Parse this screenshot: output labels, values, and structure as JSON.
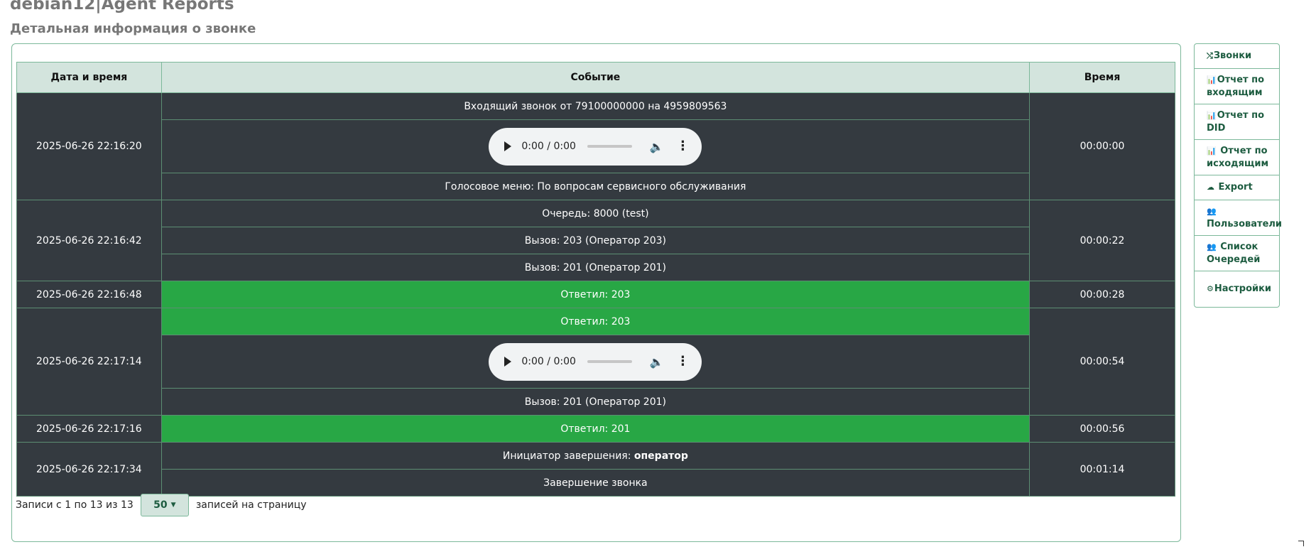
{
  "header": {
    "app_title": "debian12|Agent Reports",
    "subtitle": "Детальная информация о звонке"
  },
  "table": {
    "columns": [
      "Дата и время",
      "Событие",
      "Время"
    ],
    "groups": [
      {
        "datetime": "2025-06-26 22:16:20",
        "duration": "00:00:00",
        "events": [
          {
            "type": "text",
            "text": "Входящий звонок от 79100000000 на 4959809563"
          },
          {
            "type": "audio",
            "time": "0:00 / 0:00"
          },
          {
            "type": "text",
            "text": "Голосовое меню: По вопросам сервисного обслуживания"
          }
        ]
      },
      {
        "datetime": "2025-06-26 22:16:42",
        "duration": "00:00:22",
        "events": [
          {
            "type": "text",
            "text": "Очередь: 8000 (test)"
          },
          {
            "type": "text",
            "text": "Вызов: 203 (Оператор 203)"
          },
          {
            "type": "text",
            "text": "Вызов: 201 (Оператор 201)"
          }
        ]
      },
      {
        "datetime": "2025-06-26 22:16:48",
        "duration": "00:00:28",
        "events": [
          {
            "type": "answered",
            "text": "Ответил: 203"
          }
        ]
      },
      {
        "datetime": "2025-06-26 22:17:14",
        "duration": "00:00:54",
        "events": [
          {
            "type": "answered",
            "text": "Ответил: 203"
          },
          {
            "type": "audio",
            "time": "0:00 / 0:00"
          },
          {
            "type": "text",
            "text": "Вызов: 201 (Оператор 201)"
          }
        ]
      },
      {
        "datetime": "2025-06-26 22:17:16",
        "duration": "00:00:56",
        "events": [
          {
            "type": "answered",
            "text": "Ответил: 201"
          }
        ]
      },
      {
        "datetime": "2025-06-26 22:17:34",
        "duration": "00:01:14",
        "events": [
          {
            "type": "text",
            "text": "Инициатор завершения: ",
            "bold": "оператор"
          },
          {
            "type": "text",
            "text": "Завершение звонка"
          }
        ]
      }
    ]
  },
  "pager": {
    "info": "Записи с 1 по 13 из 13",
    "page_size": "50",
    "suffix": "записей на страницу"
  },
  "side_menu": [
    {
      "icon": "shuffle-icon",
      "glyph": "⤭",
      "label": "Звонки"
    },
    {
      "icon": "bar-chart-icon",
      "glyph": "📊",
      "label": "Отчет по входящим"
    },
    {
      "icon": "bar-chart-icon",
      "glyph": "📊",
      "label": "Отчет по DID"
    },
    {
      "icon": "bar-chart-icon",
      "glyph": "📊",
      "label": " Отчет по исходящим"
    },
    {
      "icon": "cloud-download-icon",
      "glyph": "☁",
      "label": " Export"
    },
    {
      "icon": "users-icon",
      "glyph": "👥",
      "label": "Пользователи"
    },
    {
      "icon": "users-icon",
      "glyph": "👥",
      "label": " Список Очередей"
    },
    {
      "icon": "cogs-icon",
      "glyph": "⚙",
      "label": "Настройки"
    }
  ],
  "colors": {
    "header_bg": "#d3e4dd",
    "row_bg": "#343a40",
    "answered_bg": "#28a745",
    "accent": "#1d5c40",
    "border": "#7cb89a"
  }
}
